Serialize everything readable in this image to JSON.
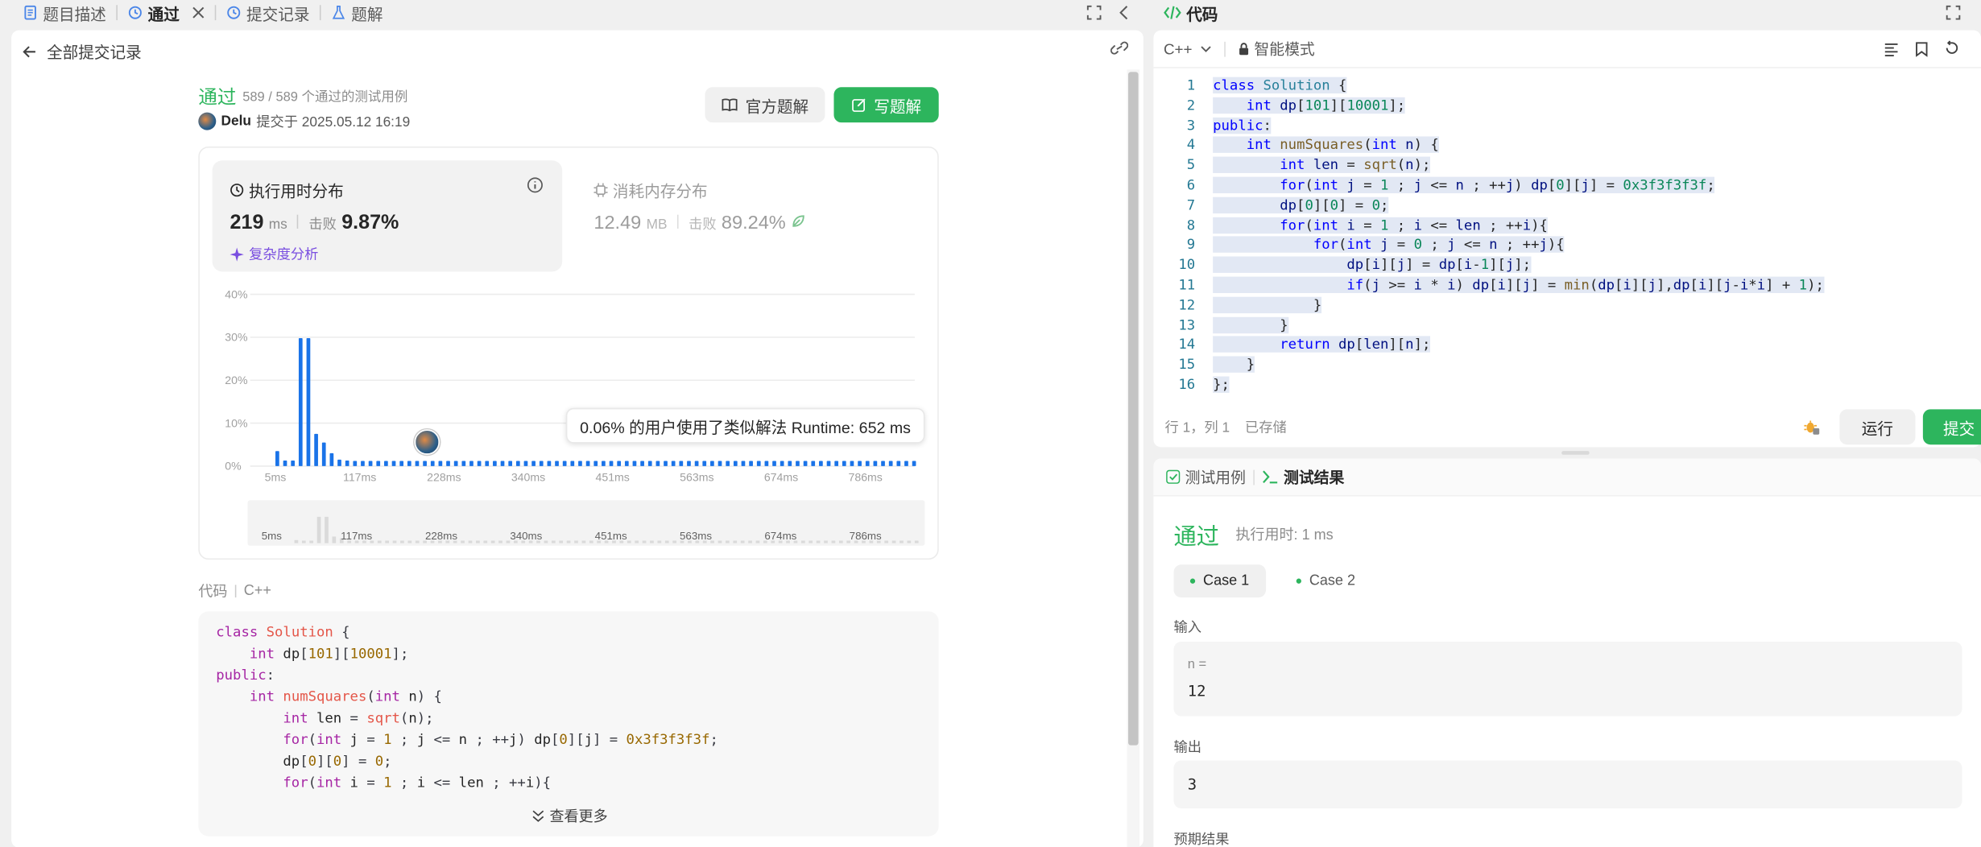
{
  "left_tabs": [
    {
      "label": "题目描述"
    },
    {
      "label": "通过"
    },
    {
      "label": "提交记录"
    },
    {
      "label": "题解"
    }
  ],
  "back_label": "全部提交记录",
  "result": {
    "status": "通过",
    "cases": "589 / 589 个通过的测试用例",
    "user": "Delu",
    "submitted": "提交于 2025.05.12 16:19"
  },
  "buttons": {
    "official": "官方题解",
    "write": "写题解"
  },
  "runtime": {
    "title": "执行用时分布",
    "value": "219",
    "unit": "ms",
    "beat_label": "击败",
    "beat": "9.87%",
    "complexity": "复杂度分析"
  },
  "memory": {
    "title": "消耗内存分布",
    "value": "12.49",
    "unit": "MB",
    "beat_label": "击败",
    "beat": "89.24%"
  },
  "tooltip": "0.06% 的用户使用了类似解法 Runtime: 652 ms",
  "chart_data": {
    "type": "bar",
    "xlabel": "",
    "ylabel": "",
    "yticks": [
      "40%",
      "30%",
      "20%",
      "10%",
      "0%"
    ],
    "ylim": [
      0,
      40
    ],
    "xticks": [
      "5ms",
      "117ms",
      "228ms",
      "340ms",
      "451ms",
      "563ms",
      "674ms",
      "786ms"
    ],
    "values": [
      3.5,
      1.3,
      1.3,
      29.8,
      29.8,
      7.5,
      5.5,
      3,
      1.5,
      1.3,
      1.2,
      1.2,
      1.2,
      1.2,
      1.2,
      1.2,
      1.2,
      1.2,
      1.2,
      1.2,
      1.2,
      1.2,
      1.2,
      1.2,
      1.2,
      1.2,
      1.2,
      1.2,
      1.2,
      1.2,
      1.2,
      1.2,
      1.2,
      1.2,
      1.2,
      1.2,
      1.2,
      1.2,
      1.2,
      1.2,
      1.2,
      1.2,
      1.2,
      1.2,
      1.2,
      1.2,
      1.2,
      1.2,
      1.2,
      1.2,
      1.2,
      1.2,
      1.2,
      1.2,
      1.2,
      1.2,
      1.2,
      1.2,
      1.2,
      1.2,
      1.2,
      1.2,
      1.2,
      1.2,
      1.2,
      1.2,
      1.2,
      1.2,
      1.2,
      1.2,
      1.2,
      1.2,
      1.2,
      1.2,
      1.2,
      1.2,
      1.2,
      1.2,
      1.2,
      1.2,
      1.2,
      1.2,
      1.2
    ],
    "accent": "#1a73e8"
  },
  "code_section": {
    "label": "代码",
    "lang": "C++",
    "more": "查看更多"
  },
  "code_preview": [
    "class Solution {",
    "    int dp[101][10001];",
    "public:",
    "    int numSquares(int n) {",
    "        int len = sqrt(n);",
    "        for(int j = 1 ; j <= n ; ++j) dp[0][j] = 0x3f3f3f3f;",
    "        dp[0][0] = 0;",
    "        for(int i = 1 ; i <= len ; ++i){"
  ],
  "editor": {
    "title": "代码",
    "lang": "C++",
    "mode": "智能模式",
    "status_pos": "行 1，列 1",
    "saved": "已存储",
    "run": "运行",
    "submit": "提交"
  },
  "editor_lines": [
    "class Solution {",
    "    int dp[101][10001];",
    "public:",
    "    int numSquares(int n) {",
    "        int len = sqrt(n);",
    "        for(int j = 1 ; j <= n ; ++j) dp[0][j] = 0x3f3f3f3f;",
    "        dp[0][0] = 0;",
    "        for(int i = 1 ; i <= len ; ++i){",
    "            for(int j = 0 ; j <= n ; ++j){",
    "                dp[i][j] = dp[i-1][j];",
    "                if(j >= i * i) dp[i][j] = min(dp[i][j],dp[i][j-i*i] + 1);",
    "            }",
    "        }",
    "        return dp[len][n];",
    "    }",
    "};"
  ],
  "line_numbers": [
    "1",
    "2",
    "3",
    "4",
    "5",
    "6",
    "7",
    "8",
    "9",
    "10",
    "11",
    "12",
    "13",
    "14",
    "15",
    "16"
  ],
  "tests": {
    "tab_cases": "测试用例",
    "tab_result": "测试结果",
    "status": "通过",
    "time": "执行用时: 1 ms",
    "case1": "Case 1",
    "case2": "Case 2",
    "input_label": "输入",
    "input_var": "n =",
    "input_val": "12",
    "output_label": "输出",
    "output_val": "3",
    "expected_label": "预期结果"
  }
}
